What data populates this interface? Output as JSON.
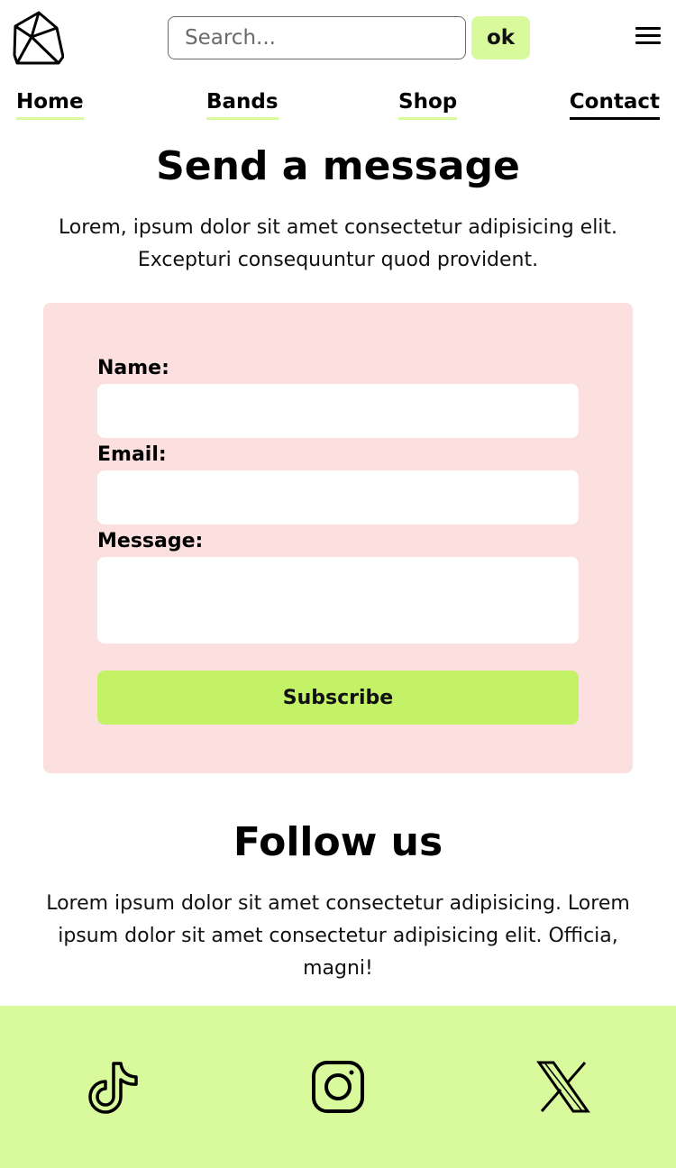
{
  "header": {
    "logo_icon": "gem-logo-icon",
    "search_placeholder": "Search...",
    "search_value": "",
    "search_button_label": "ok",
    "menu_icon": "hamburger-menu-icon"
  },
  "nav": {
    "items": [
      {
        "label": "Home",
        "active": false
      },
      {
        "label": "Bands",
        "active": false
      },
      {
        "label": "Shop",
        "active": false
      },
      {
        "label": "Contact",
        "active": true
      }
    ]
  },
  "contact": {
    "title": "Send a message",
    "intro": "Lorem, ipsum dolor sit amet consectetur adipisicing elit. Excepturi consequuntur quod provident.",
    "form": {
      "name_label": "Name:",
      "name_value": "",
      "email_label": "Email:",
      "email_value": "",
      "message_label": "Message:",
      "message_value": "",
      "submit_label": "Subscribe"
    }
  },
  "follow": {
    "title": "Follow us",
    "text": "Lorem ipsum dolor sit amet consectetur adipisicing. Lorem ipsum dolor sit amet consectetur adipisicing elit. Officia, magni!"
  },
  "footer": {
    "social_icons": [
      "tiktok-icon",
      "instagram-icon",
      "x-icon"
    ]
  },
  "colors": {
    "accent_green": "#d9f99d",
    "button_green": "#c4f267",
    "form_background": "#fce0e0",
    "text": "#000000"
  }
}
